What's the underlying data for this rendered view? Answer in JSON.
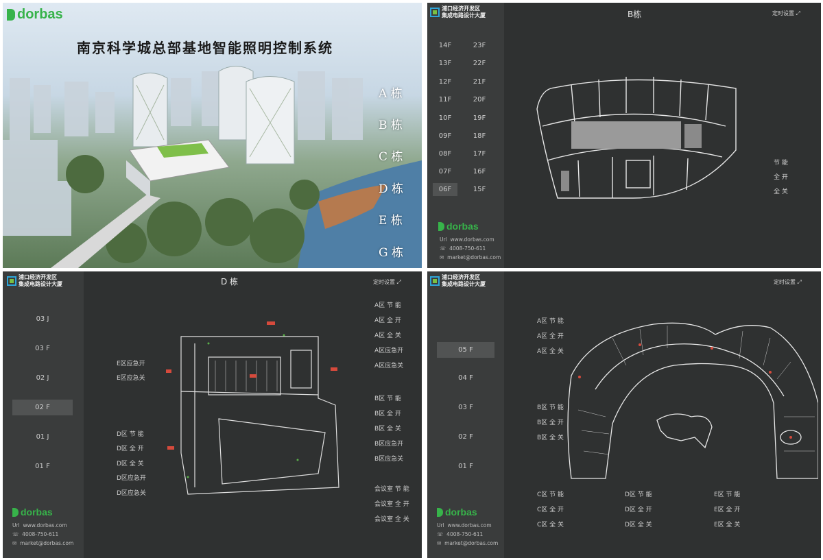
{
  "overview": {
    "brand": "dorbas",
    "title": "南京科学城总部基地智能照明控制系统",
    "buildings": [
      "A 栋",
      "B 栋",
      "C 栋",
      "D 栋",
      "E 栋",
      "G 栋"
    ]
  },
  "logo": {
    "line1": "浦口经济开发区",
    "line2": "集成电路设计大厦"
  },
  "timer_label": "定时设置",
  "brand": "dorbas",
  "contact": {
    "url_label": "Url",
    "url": "www.dorbas.com",
    "phone": "4008-750-611",
    "email": "market@dorbas.com"
  },
  "panel_b": {
    "title": "B栋",
    "floors_left": [
      "14F",
      "13F",
      "12F",
      "11F",
      "10F",
      "09F",
      "08F",
      "07F",
      "06F"
    ],
    "floors_right": [
      "23F",
      "22F",
      "21F",
      "20F",
      "19F",
      "18F",
      "17F",
      "16F",
      "15F"
    ],
    "selected": "06F",
    "controls": [
      "节 能",
      "全 开",
      "全 关"
    ]
  },
  "panel_d": {
    "title": "D 栋",
    "floors": [
      "03 J",
      "03 F",
      "02 J",
      "02 F",
      "01 J",
      "01 F"
    ],
    "selected": "02 F",
    "left_controls_e": [
      "E区应急开",
      "E区应急关"
    ],
    "left_controls_d": [
      "D区 节 能",
      "D区 全 开",
      "D区 全 关",
      "D区应急开",
      "D区应急关"
    ],
    "right_a": [
      "A区 节 能",
      "A区 全 开",
      "A区 全 关",
      "A区应急开",
      "A区应急关"
    ],
    "right_b": [
      "B区 节 能",
      "B区 全 开",
      "B区 全 关",
      "B区应急开",
      "B区应急关"
    ],
    "right_meeting": [
      "会议室 节 能",
      "会议室 全 开",
      "会议室 全 关"
    ]
  },
  "panel_e": {
    "floors": [
      "05 F",
      "04 F",
      "03 F",
      "02 F",
      "01 F"
    ],
    "selected": "05 F",
    "a_controls": [
      "A区 节 能",
      "A区 全 开",
      "A区 全 关"
    ],
    "b_controls": [
      "B区 节 能",
      "B区 全 开",
      "B区 全 关"
    ],
    "c_controls": [
      "C区 节 能",
      "C区 全 开",
      "C区 全 关"
    ],
    "d_controls": [
      "D区 节 能",
      "D区 全 开",
      "D区 全 关"
    ],
    "e_controls": [
      "E区 节 能",
      "E区 全 开",
      "E区 全 关"
    ]
  }
}
